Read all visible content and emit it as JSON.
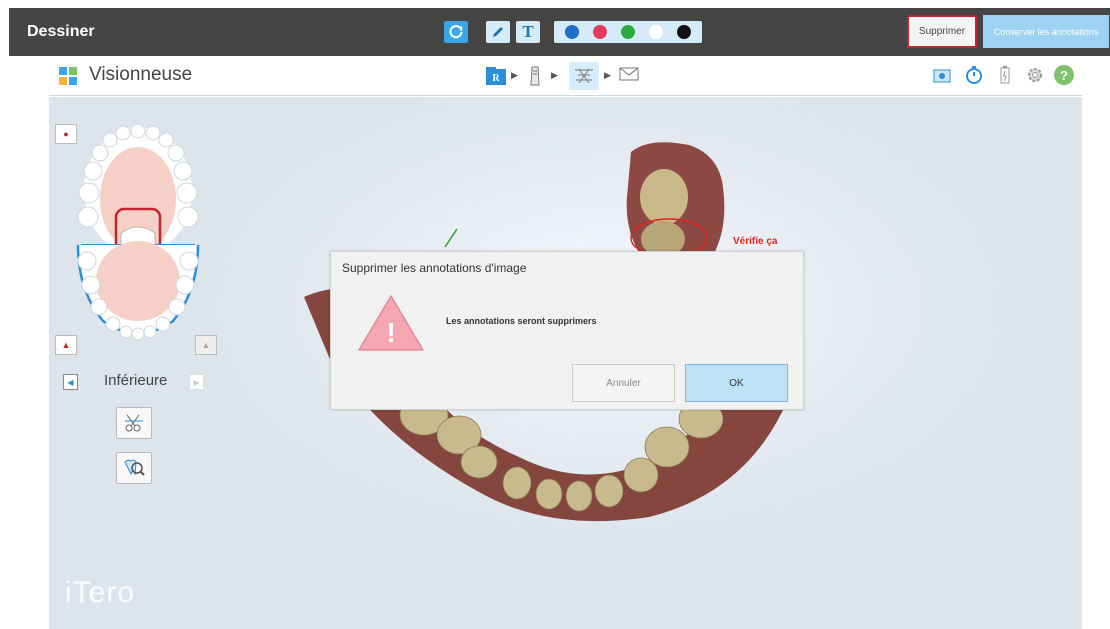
{
  "drawbar": {
    "title": "Dessiner",
    "delete_label": "Supprimer",
    "keep_label": "Conserver les annotations",
    "text_tool_glyph": "T",
    "palette": [
      "#1e6fc8",
      "#e63a5a",
      "#2eaa3a",
      "#ffffff",
      "#111111"
    ]
  },
  "viewer": {
    "title": "Visionneuse",
    "workflow_icons": [
      "rx-icon",
      "scanner-icon",
      "viewer-icon",
      "send-icon"
    ],
    "right_icons": [
      "camera-icon",
      "timer-icon",
      "battery-icon",
      "gear-icon",
      "help-icon"
    ],
    "help_glyph": "?",
    "rx_glyph": "R"
  },
  "left_panel": {
    "jaw_label": "Inférieure"
  },
  "annotation": {
    "text": "Vérifie ça"
  },
  "dialog": {
    "title": "Supprimer les annotations d'image",
    "message": "Les annotations seront supprimers",
    "cancel_label": "Annuler",
    "ok_label": "OK",
    "warn_glyph": "!"
  },
  "brand": {
    "logo": "iTero"
  },
  "colors": {
    "accent": "#3aa7e8",
    "toolbar_bg": "#454545",
    "delete_border": "#c0272d",
    "annotation_red": "#e2231a",
    "warning": "#f4a7b0"
  }
}
